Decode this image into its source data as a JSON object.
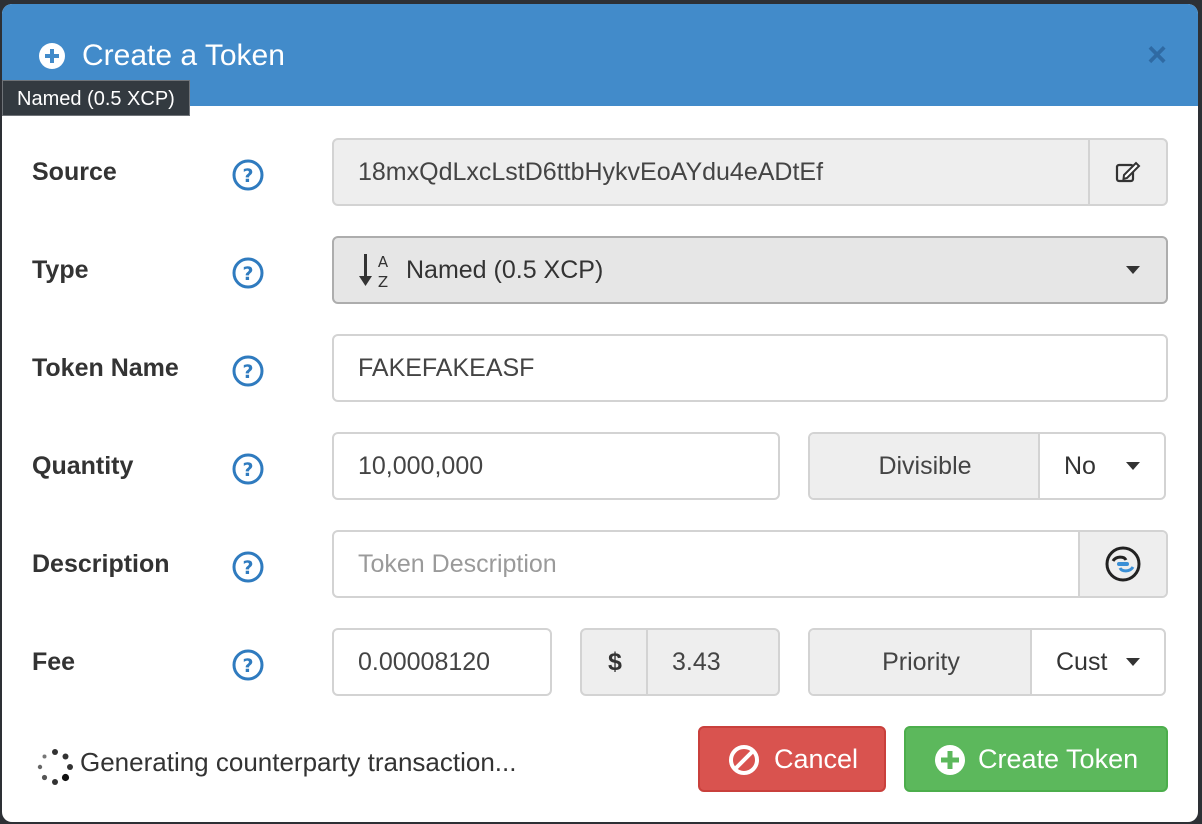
{
  "modal": {
    "title": "Create a Token",
    "close_symbol": "×"
  },
  "tooltip": {
    "text": "Named (0.5 XCP)"
  },
  "form": {
    "source": {
      "label": "Source",
      "value": "18mxQdLxcLstD6ttbHykvEoAYdu4eADtEf",
      "addon_icon": "edit-icon"
    },
    "type": {
      "label": "Type",
      "selected": "Named (0.5 XCP)",
      "icon": "sort-alpha-icon"
    },
    "token_name": {
      "label": "Token Name",
      "value": "FAKEFAKEASF"
    },
    "quantity": {
      "label": "Quantity",
      "value": "10,000,000",
      "divisible_label": "Divisible",
      "divisible_value": "No"
    },
    "description": {
      "label": "Description",
      "value": "",
      "placeholder": "Token Description",
      "addon_icon": "link-icon"
    },
    "fee": {
      "label": "Fee",
      "value": "0.00008120",
      "currency_symbol": "$",
      "usd_value": "3.43",
      "priority_label": "Priority",
      "priority_value": "Cust"
    }
  },
  "footer": {
    "status": "Generating counterparty transaction...",
    "cancel_label": "Cancel",
    "create_label": "Create Token"
  },
  "colors": {
    "header": "#428bca",
    "cancel": "#d9534f",
    "create": "#5cb85c",
    "help_icon": "#2f7bbf"
  }
}
